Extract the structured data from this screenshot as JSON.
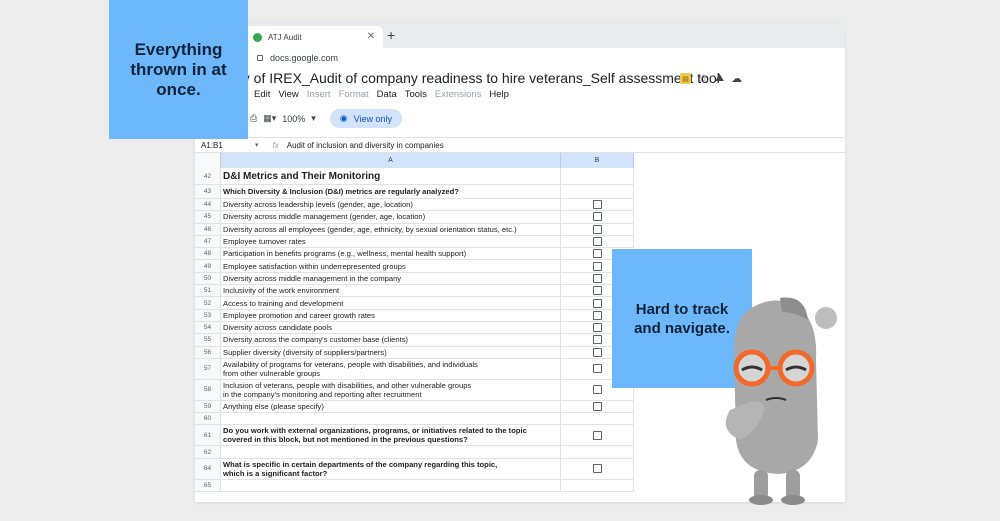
{
  "browser": {
    "tab_title": "ATJ Audit",
    "url": "docs.google.com"
  },
  "doc": {
    "title": "py of IREX_Audit of company readiness to hire veterans_Self assessment tool",
    "menu": [
      "Edit",
      "View",
      "Insert",
      "Format",
      "Data",
      "Tools",
      "Extensions",
      "Help"
    ],
    "menu_dim": [
      false,
      false,
      true,
      true,
      false,
      false,
      true,
      false
    ],
    "zoom": "100%",
    "view_only": "View only",
    "cell_ref": "A1:B1",
    "fx": "fx",
    "formula": "Audit of inclusion and diversity in companies",
    "col_a": "A",
    "col_b": "B"
  },
  "rows": [
    {
      "n": "42",
      "text": "D&I Metrics and Their Monitoring",
      "style": "title",
      "check": false
    },
    {
      "n": "43",
      "text": "Which Diversity & Inclusion (D&I) metrics are regularly analyzed?",
      "style": "bold",
      "check": false
    },
    {
      "n": "44",
      "text": "Diversity across leadership levels (gender, age, location)",
      "style": "",
      "check": true
    },
    {
      "n": "45",
      "text": "Diversity across middle management (gender, age, location)",
      "style": "",
      "check": true
    },
    {
      "n": "46",
      "text": "Diversity across all employees (gender, age, ethnicity, by sexual orientation status, etc.)",
      "style": "",
      "check": true
    },
    {
      "n": "47",
      "text": "Employee turnover rates",
      "style": "",
      "check": true
    },
    {
      "n": "48",
      "text": "Participation in benefits programs (e.g., wellness, mental health support)",
      "style": "",
      "check": true
    },
    {
      "n": "49",
      "text": "Employee satisfaction within underrepresented groups",
      "style": "",
      "check": true
    },
    {
      "n": "50",
      "text": "Diversity across middle management in the company",
      "style": "",
      "check": true
    },
    {
      "n": "51",
      "text": "Inclusivity of the work environment",
      "style": "",
      "check": true
    },
    {
      "n": "52",
      "text": "Access to training and development",
      "style": "",
      "check": true
    },
    {
      "n": "53",
      "text": "Employee promotion and career growth rates",
      "style": "",
      "check": true
    },
    {
      "n": "54",
      "text": "Diversity across candidate pools",
      "style": "",
      "check": true
    },
    {
      "n": "55",
      "text": "Diversity across the company's customer base (clients)",
      "style": "",
      "check": true
    },
    {
      "n": "56",
      "text": "Supplier diversity (diversity of suppliers/partners)",
      "style": "",
      "check": true
    },
    {
      "n": "57",
      "text": "Availability of programs for veterans, people with disabilities, and individuals\nfrom other vulnerable groups",
      "style": "",
      "check": true
    },
    {
      "n": "58",
      "text": "Inclusion of veterans, people with disabilities, and other vulnerable groups\nin the company's monitoring and reporting after recruitment",
      "style": "",
      "check": true
    },
    {
      "n": "59",
      "text": "Anything else (please specify)",
      "style": "",
      "check": true
    },
    {
      "n": "60",
      "text": "",
      "style": "",
      "check": false
    },
    {
      "n": "61",
      "text": "Do you work with external organizations, programs, or initiatives related to the topic\ncovered in this block, but not mentioned in the previous questions?",
      "style": "bold",
      "check": true
    },
    {
      "n": "62",
      "text": "",
      "style": "",
      "check": false
    },
    {
      "n": "64",
      "text": "What is specific in certain departments of the company regarding this topic,\nwhich is a significant factor?",
      "style": "bold",
      "check": true
    },
    {
      "n": "65",
      "text": "",
      "style": "",
      "check": false
    }
  ],
  "callouts": {
    "left": "Everything thrown in at once.",
    "right": "Hard to track and navigate."
  },
  "colors": {
    "callout": "#6db8fb",
    "view_only_bg": "#d3e3fd",
    "column_header": "#d3e3fd"
  }
}
